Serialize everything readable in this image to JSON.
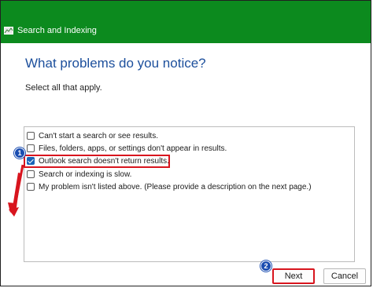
{
  "window": {
    "title": "Search and Indexing",
    "titlebar_color": "#0c8a1e"
  },
  "heading": "What problems do you notice?",
  "instruction": "Select all that apply.",
  "options": [
    {
      "label": "Can't start a search or see results.",
      "checked": false
    },
    {
      "label": "Files, folders, apps, or settings don't appear in results.",
      "checked": false
    },
    {
      "label": "Outlook search doesn't return results.",
      "checked": true
    },
    {
      "label": "Search or indexing is slow.",
      "checked": false
    },
    {
      "label": "My problem isn't listed above. (Please provide a description on the next page.)",
      "checked": false
    }
  ],
  "annotations": {
    "step1": "1",
    "step2": "2",
    "highlight_color": "#d8151e",
    "badge_color": "#1a4db1"
  },
  "buttons": {
    "next": "Next",
    "cancel": "Cancel"
  }
}
